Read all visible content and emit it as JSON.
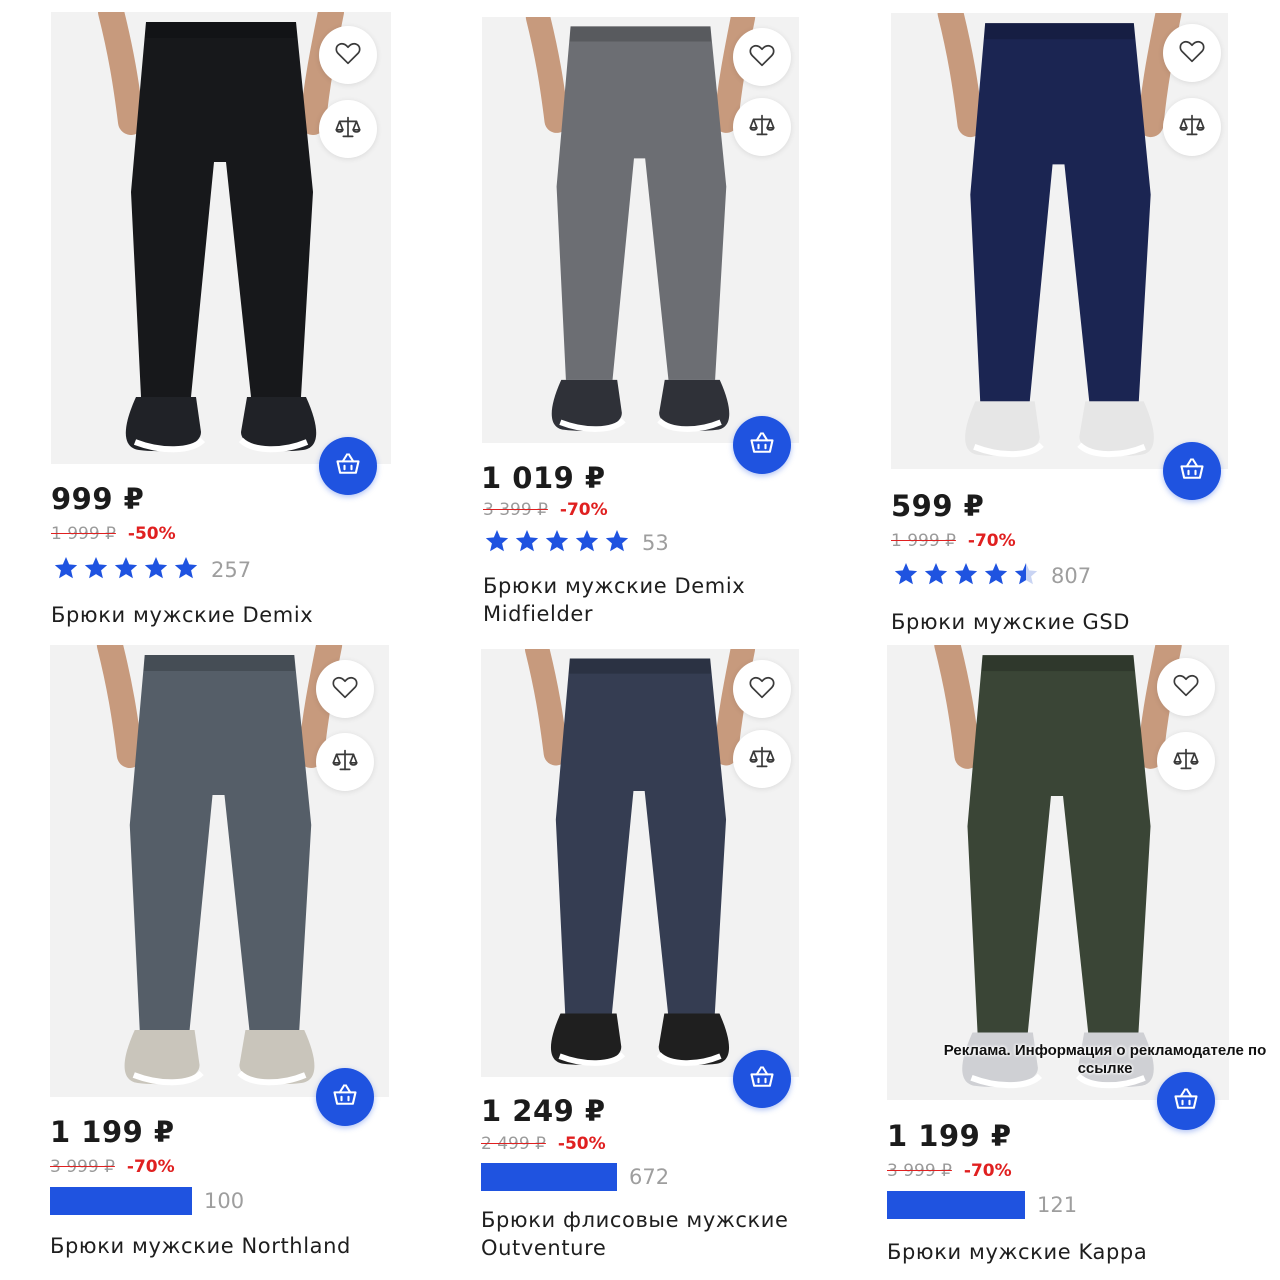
{
  "colors": {
    "accent": "#1f53e0",
    "discount": "#e02020",
    "muted": "#9e9e9e"
  },
  "icons": {
    "favorite": "heart-icon",
    "compare": "scales-icon",
    "cart": "basket-icon",
    "rating": "star-icon"
  },
  "products": [
    {
      "price": "999 ₽",
      "old_price": "1 999 ₽",
      "discount": "-50%",
      "stars": 5,
      "reviews": "257",
      "title": "Брюки мужские Demix",
      "pants_color": "#17181b",
      "shoe_color": "#202227"
    },
    {
      "price": "1 019 ₽",
      "old_price": "3 399 ₽",
      "discount": "-70%",
      "stars": 5,
      "reviews": "53",
      "title": "Брюки мужские Demix Midfielder",
      "pants_color": "#6c6e73",
      "shoe_color": "#2f3138"
    },
    {
      "price": "599 ₽",
      "old_price": "1 999 ₽",
      "discount": "-70%",
      "stars": 4.5,
      "reviews": "807",
      "title": "Брюки мужские GSD",
      "pants_color": "#1b2552",
      "shoe_color": "#e6e6e6"
    },
    {
      "price": "1 199 ₽",
      "old_price": "3 999 ₽",
      "discount": "-70%",
      "stars": null,
      "reviews": "100",
      "title": "Брюки мужские Northland",
      "pants_color": "#555e68",
      "shoe_color": "#c9c5bb"
    },
    {
      "price": "1 249 ₽",
      "old_price": "2 499 ₽",
      "discount": "-50%",
      "stars": null,
      "reviews": "672",
      "title": "Брюки флисовые мужские Outventure",
      "pants_color": "#353d52",
      "shoe_color": "#1f1f1f"
    },
    {
      "price": "1 199 ₽",
      "old_price": "3 999 ₽",
      "discount": "-70%",
      "stars": null,
      "reviews": "121",
      "title": "Брюки мужские Kappa",
      "pants_color": "#3a4536",
      "shoe_color": "#cfd0d4"
    }
  ],
  "ad_notice": "Реклама. Информация о рекламодателе по ссылке"
}
